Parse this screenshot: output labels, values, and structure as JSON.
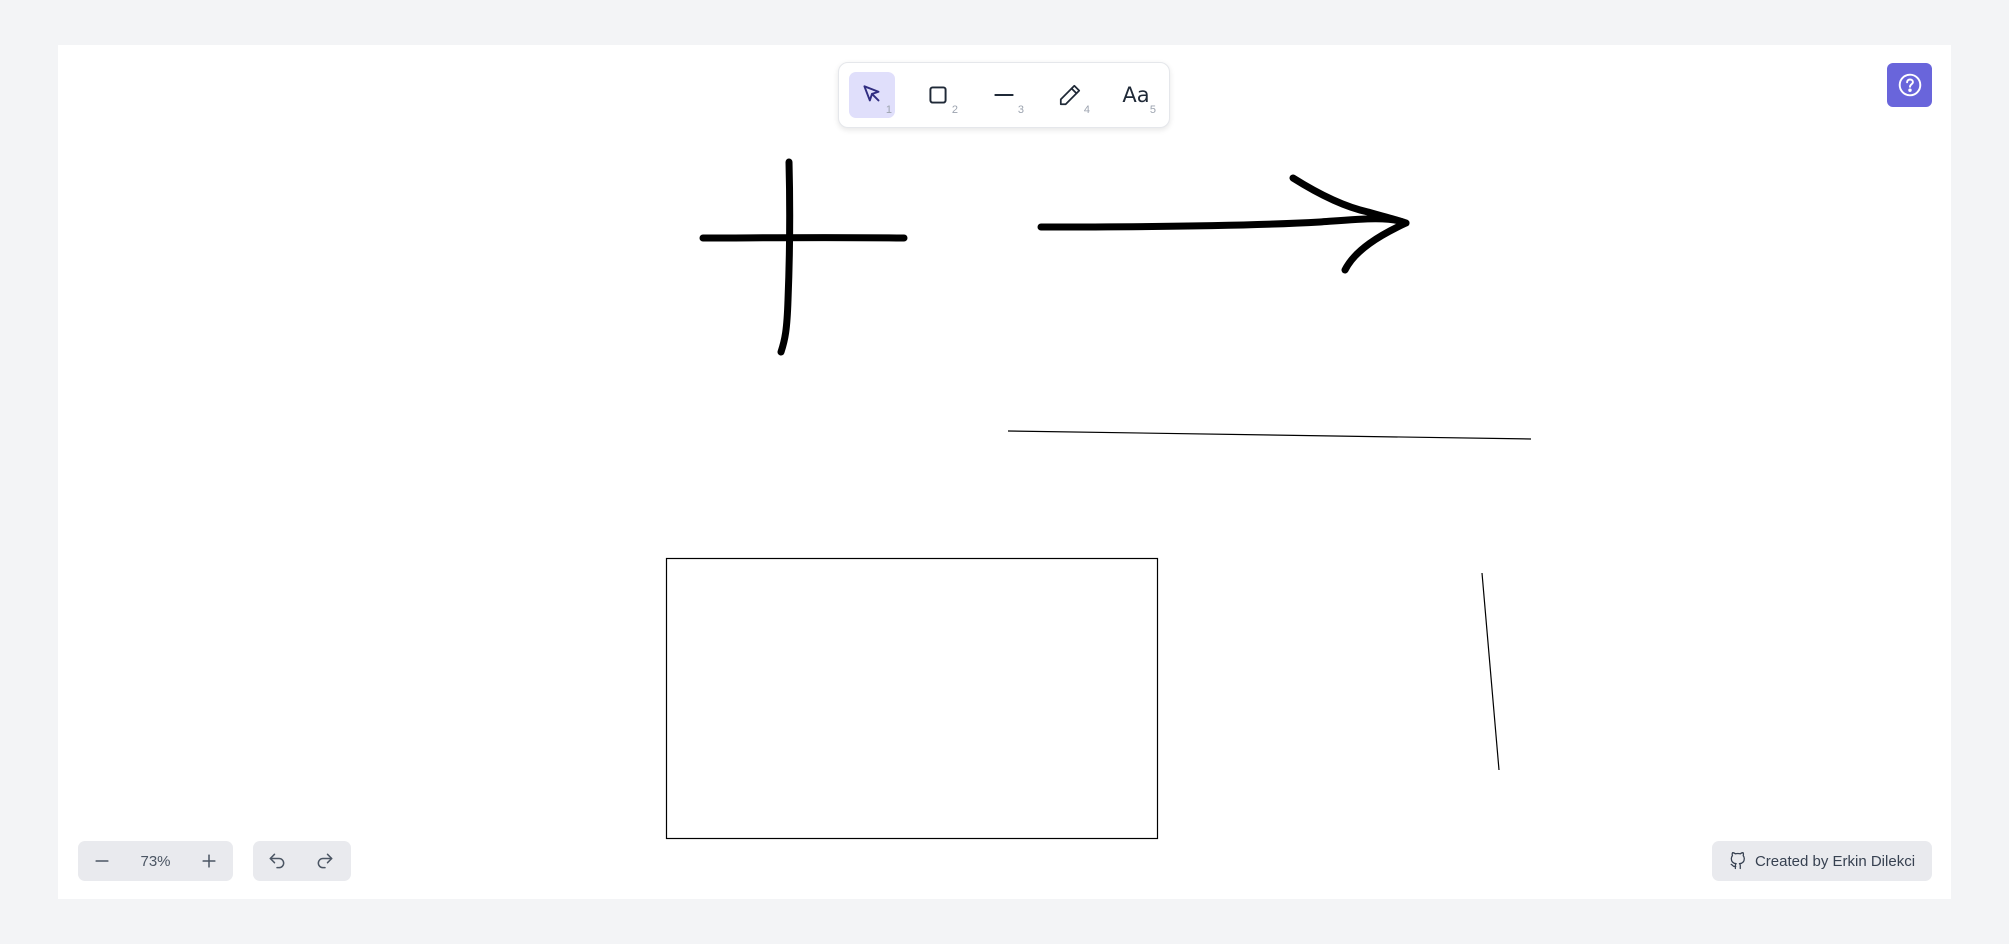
{
  "toolbar": {
    "tools": [
      {
        "name": "select",
        "icon": "cursor-icon",
        "shortcut": "1",
        "active": true
      },
      {
        "name": "rectangle",
        "icon": "rectangle-icon",
        "shortcut": "2",
        "active": false
      },
      {
        "name": "line",
        "icon": "line-icon",
        "shortcut": "3",
        "active": false
      },
      {
        "name": "pencil",
        "icon": "pencil-icon",
        "shortcut": "4",
        "active": false
      },
      {
        "name": "text",
        "icon": "text-icon",
        "label": "Aa",
        "shortcut": "5",
        "active": false
      }
    ]
  },
  "help": {
    "icon": "question-circle-icon"
  },
  "zoom": {
    "value": "73%",
    "out_icon": "minus-icon",
    "in_icon": "plus-icon"
  },
  "history": {
    "undo_icon": "undo-icon",
    "redo_icon": "redo-icon"
  },
  "credit": {
    "label": "Created by Erkin Dilekci",
    "icon": "github-icon"
  },
  "colors": {
    "background": "#f3f4f6",
    "canvas": "#ffffff",
    "accent": "#6965db",
    "active_tool": "#e0dffb",
    "stroke": "#000000"
  },
  "canvas_shapes": [
    {
      "type": "freehand",
      "depicts": "plus-sign"
    },
    {
      "type": "freehand",
      "depicts": "arrow"
    },
    {
      "type": "line"
    },
    {
      "type": "rectangle"
    },
    {
      "type": "line"
    }
  ]
}
